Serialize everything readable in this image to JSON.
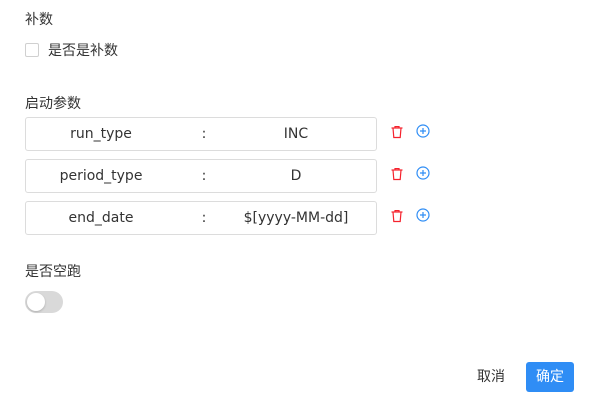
{
  "supplement": {
    "title": "补数",
    "checkbox_label": "是否是补数",
    "checked": false
  },
  "params": {
    "title": "启动参数",
    "separator": ":",
    "rows": [
      {
        "key": "run_type",
        "value": "INC"
      },
      {
        "key": "period_type",
        "value": "D"
      },
      {
        "key": "end_date",
        "value": "$[yyyy-MM-dd]"
      }
    ]
  },
  "dry_run": {
    "title": "是否空跑",
    "enabled": false
  },
  "footer": {
    "cancel_label": "取消",
    "ok_label": "确定"
  },
  "colors": {
    "accent": "#2f8df5",
    "delete": "#f5222d",
    "switch_off": "#d9d9d9"
  },
  "icons": {
    "delete": "trash-icon",
    "add": "plus-circle-icon"
  }
}
